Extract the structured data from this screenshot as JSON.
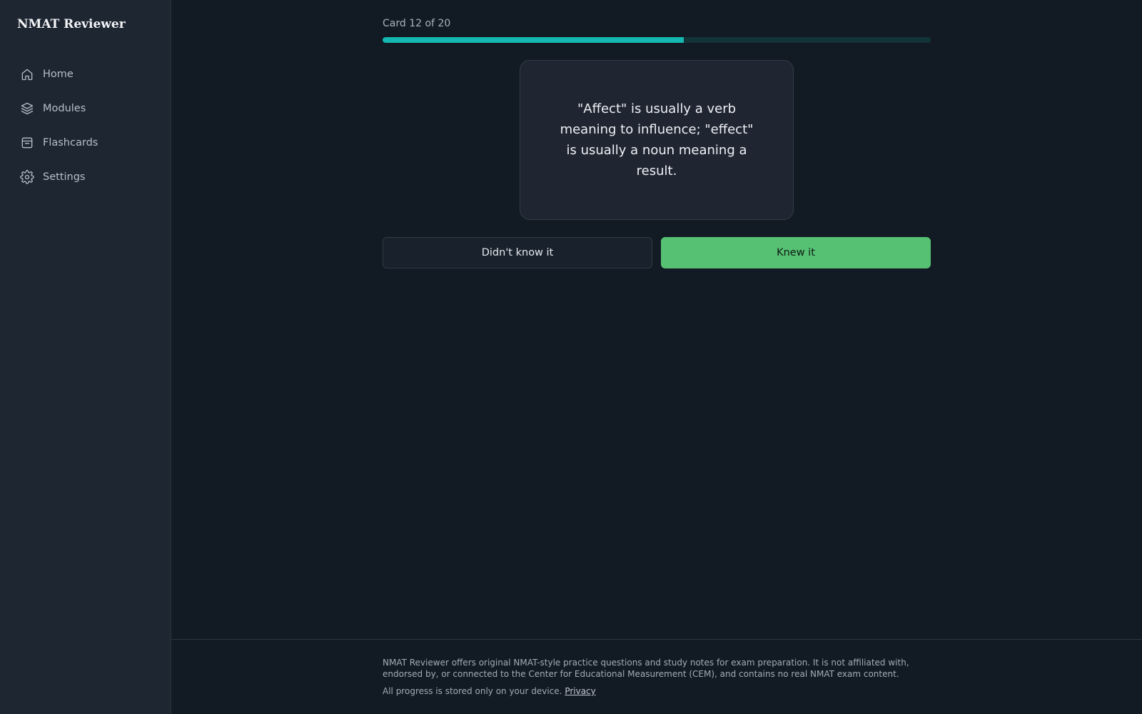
{
  "app": {
    "title": "NMAT Reviewer"
  },
  "sidebar": {
    "items": [
      {
        "label": "Home",
        "icon": "home-icon"
      },
      {
        "label": "Modules",
        "icon": "layers-icon"
      },
      {
        "label": "Flashcards",
        "icon": "inbox-icon"
      },
      {
        "label": "Settings",
        "icon": "gear-icon"
      }
    ]
  },
  "session": {
    "counter": "Card 12 of 20",
    "progress_fraction": 0.55,
    "card_text": "\"Affect\" is usually a verb meaning to influence; \"effect\" is usually a noun meaning a result.",
    "didnt_know_label": "Didn't know it",
    "knew_label": "Knew it"
  },
  "footer": {
    "disclaimer": "NMAT Reviewer offers original NMAT-style practice questions and study notes for exam preparation. It is not affiliated with, endorsed by, or connected to the Center for Educational Measurement (CEM), and contains no real NMAT exam content.",
    "storage_note": "All progress is stored only on your device.",
    "privacy_link": "Privacy"
  },
  "colors": {
    "accent": "#14b8b0",
    "success": "#56c073",
    "background": "#121a23",
    "sidebar": "#1e2632"
  }
}
